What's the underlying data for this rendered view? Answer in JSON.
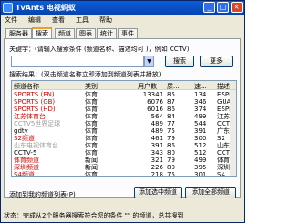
{
  "window": {
    "title": "TvAnts 电视蚂蚁",
    "minimize": "_",
    "maximize": "□",
    "close": "×"
  },
  "menu": [
    "文件",
    "编辑",
    "查看",
    "工具",
    "帮助"
  ],
  "tabs": [
    "服务器",
    "搜索",
    "频道",
    "图表",
    "统计",
    "事件"
  ],
  "active_tab": "搜索",
  "search": {
    "keyword_label": "关键字：(请输入搜索条件 (频道名称、描述均可 )，例如 CCTV)",
    "input_value": "",
    "dropdown_glyph": "▼",
    "search_button": "搜索",
    "more_button": "更多"
  },
  "results": {
    "label": "搜索结果：(双击频道名称立即添加到频道列表并播放)",
    "columns": [
      "频道名称",
      "类别",
      "用户数",
      "质...",
      "速...",
      "描述"
    ],
    "rows": [
      {
        "name": "SPORTS (EN)",
        "type": "体育",
        "users": "13341",
        "q": "85",
        "spd": "134",
        "desc": "ESPN",
        "color": "#d40000"
      },
      {
        "name": "SPORTS (GB)",
        "type": "体育",
        "users": "6076",
        "spd": "346",
        "q": "87",
        "desc": "GUANG",
        "color": "#d40000"
      },
      {
        "name": "SPORTS (HD)",
        "type": "体育",
        "users": "6016",
        "q": "86",
        "spd": "374",
        "desc": "ESPN",
        "color": "#d40000"
      },
      {
        "name": "江苏体育台",
        "type": "体育",
        "users": "564",
        "q": "84",
        "spd": "499",
        "desc": "江苏",
        "color": "#d40000"
      },
      {
        "name": "CCTV5世界足球",
        "type": "体育",
        "users": "489",
        "q": "77",
        "spd": "544",
        "desc": "CCTV",
        "color": "#a0a0a0"
      },
      {
        "name": "gdty",
        "type": "体育",
        "users": "489",
        "q": "75",
        "spd": "391",
        "desc": "广东",
        "color": "#000000"
      },
      {
        "name": "S2频道",
        "type": "体育",
        "users": "461",
        "q": "79",
        "spd": "300",
        "desc": "S2",
        "color": "#d40000"
      },
      {
        "name": "山东电视体育台",
        "type": "体育",
        "users": "391",
        "q": "86",
        "spd": "512",
        "desc": "山东",
        "color": "#a0a0a0"
      },
      {
        "name": "CCTV-5",
        "type": "体育",
        "users": "343",
        "q": "80",
        "spd": "512",
        "desc": "CCTV",
        "color": "#000000"
      },
      {
        "name": "体育频道",
        "type": "新闻",
        "users": "321",
        "q": "79",
        "spd": "499",
        "desc": "体育",
        "color": "#d40000"
      },
      {
        "name": "深圳频道",
        "type": "新闻",
        "users": "226",
        "q": "80",
        "spd": "395",
        "desc": "深圳",
        "color": "#d40000"
      },
      {
        "name": "S4频道",
        "type": "体育",
        "users": "218",
        "q": "75",
        "spd": "301",
        "desc": "S4",
        "color": "#d40000"
      }
    ]
  },
  "add_section": {
    "label": "添加到我的频道列表(P)",
    "add_selected": "添加选中频道",
    "add_all": "添加全部频道"
  },
  "status": {
    "text": "状态：完成从2个服务器搜索符合您的条件 \"\" 的频道，总共搜到"
  }
}
